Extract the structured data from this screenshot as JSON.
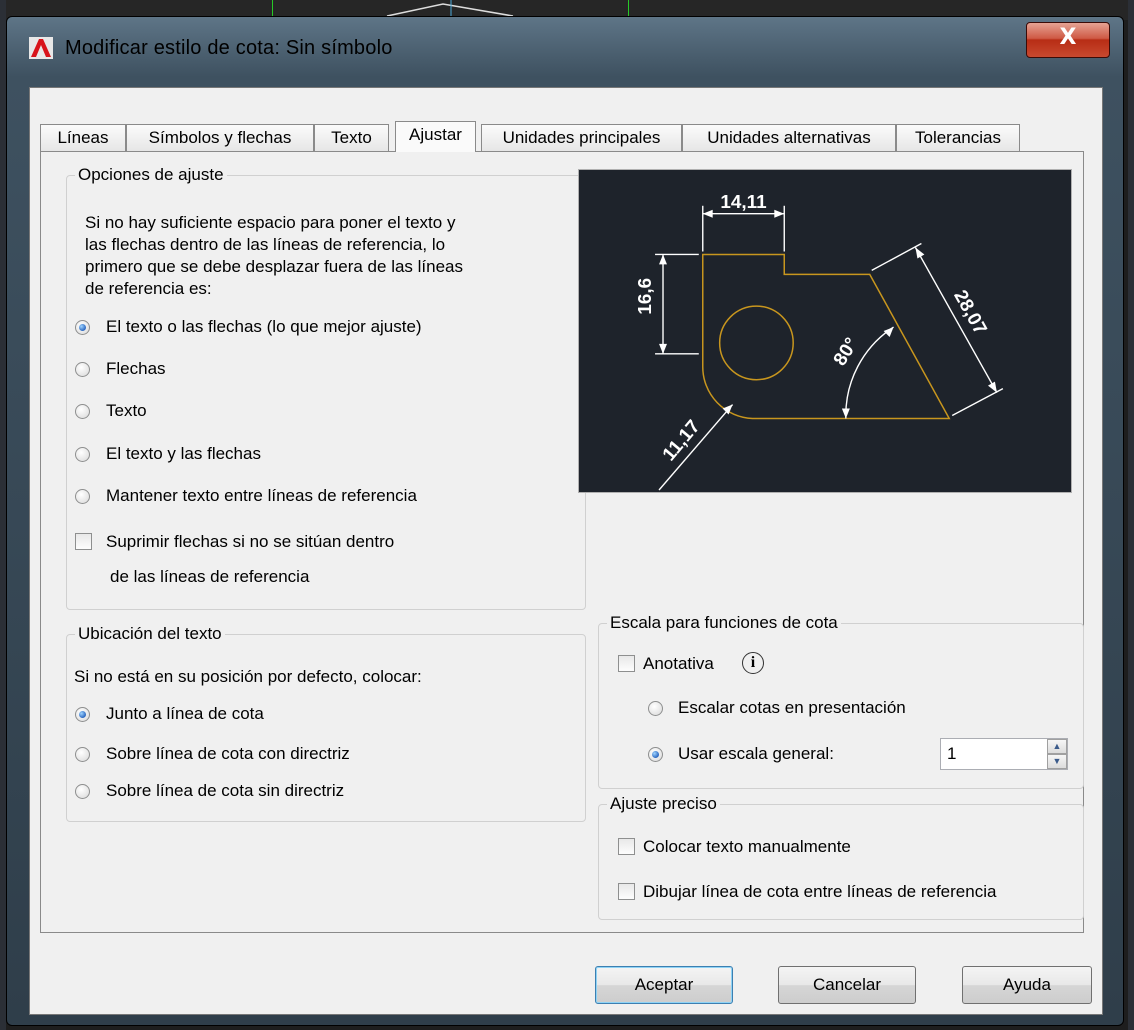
{
  "window": {
    "title": "Modificar estilo de cota: Sin símbolo",
    "close_label": "X"
  },
  "tabs": [
    {
      "label": "Líneas"
    },
    {
      "label": "Símbolos y flechas"
    },
    {
      "label": "Texto"
    },
    {
      "label": "Ajustar"
    },
    {
      "label": "Unidades principales"
    },
    {
      "label": "Unidades alternativas"
    },
    {
      "label": "Tolerancias"
    }
  ],
  "active_tab": "Ajustar",
  "fit_options": {
    "legend": "Opciones de ajuste",
    "description": "Si no hay suficiente espacio para poner el texto y\nlas flechas dentro de las líneas de referencia, lo\nprimero que se debe desplazar fuera de las líneas\nde referencia es:",
    "options": [
      "El texto o las flechas (lo que mejor ajuste)",
      "Flechas",
      "Texto",
      "El texto y las flechas",
      "Mantener texto entre líneas de referencia"
    ],
    "selected": "El texto o las flechas (lo que mejor ajuste)",
    "suppress_label_1": "Suprimir flechas si no se sitúan dentro",
    "suppress_label_2": "de las líneas de referencia",
    "suppress_checked": false
  },
  "preview": {
    "dim_top": "14,11",
    "dim_left": "16,6",
    "dim_right": "28,07",
    "dim_angle": "80°",
    "dim_radius": "11,17"
  },
  "text_placement": {
    "legend": "Ubicación del texto",
    "description": "Si no está en su posición por defecto, colocar:",
    "options": [
      "Junto a línea de cota",
      "Sobre línea de cota con directriz",
      "Sobre línea de cota sin directriz"
    ],
    "selected": "Junto a línea de cota"
  },
  "scale": {
    "legend": "Escala para funciones de cota",
    "annotative_label": "Anotativa",
    "annotative_checked": false,
    "info_glyph": "i",
    "option_layout": "Escalar cotas en presentación",
    "option_overall": "Usar escala general:",
    "selected": "Usar escala general:",
    "overall_value": "1"
  },
  "fine_tuning": {
    "legend": "Ajuste preciso",
    "manual_text_label": "Colocar texto manualmente",
    "manual_text_checked": false,
    "draw_dimline_label": "Dibujar línea de cota entre líneas de referencia",
    "draw_dimline_checked": false
  },
  "buttons": {
    "ok": "Aceptar",
    "cancel": "Cancelar",
    "help": "Ayuda"
  },
  "colors": {
    "preview_bg": "#1e232b",
    "preview_geometry": "#c8961e",
    "preview_dims": "#ffffff",
    "close_button": "#c8492f"
  }
}
